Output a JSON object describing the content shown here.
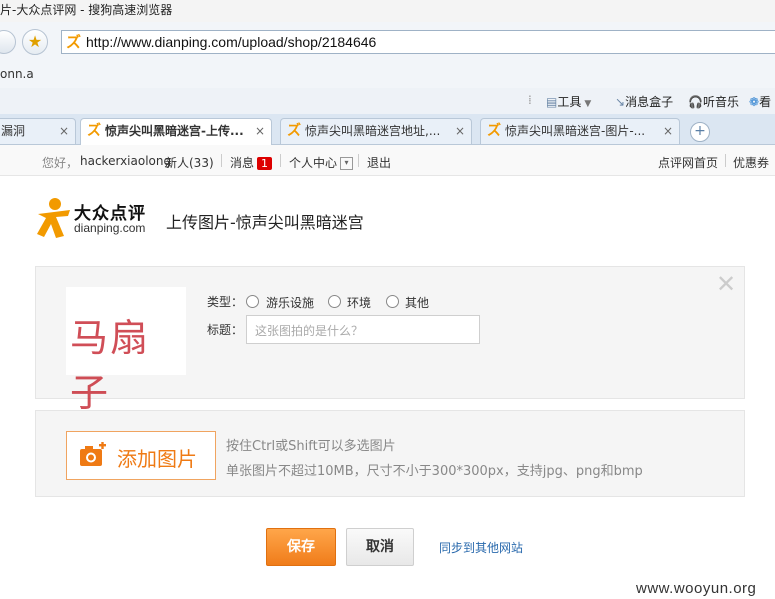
{
  "window": {
    "title": "片-大众点评网 - 搜狗高速浏览器"
  },
  "address": {
    "url": "http://www.dianping.com/upload/shop/2184646"
  },
  "bookmarks": {
    "item": "onn.a"
  },
  "toolbar": {
    "tools": "工具",
    "msgbox": "消息盒子",
    "music": "听音乐",
    "more": "看"
  },
  "tabs": [
    {
      "label": "漏洞",
      "close": "×"
    },
    {
      "label": "惊声尖叫黑暗迷宫-上传...",
      "close": "×"
    },
    {
      "label": "惊声尖叫黑暗迷宫地址,...",
      "close": "×"
    },
    {
      "label": "惊声尖叫黑暗迷宫-图片-...",
      "close": "×"
    }
  ],
  "newtab": "+",
  "userbar": {
    "greeting": "您好，",
    "username": "hackerxiaolong",
    "newpeople": "新人(33)",
    "messages": "消息",
    "msgcount": "1",
    "personal": "个人中心",
    "logout": "退出",
    "home": "点评网首页",
    "coupons": "优惠券"
  },
  "logo": {
    "cn": "大众点评",
    "en": "dianping.com"
  },
  "page": {
    "title": "上传图片-惊声尖叫黑暗迷宫"
  },
  "form": {
    "thumb_text": "马扇子",
    "type_label": "类型：",
    "options": [
      "游乐设施",
      "环境",
      "其他"
    ],
    "title_label": "标题：",
    "title_placeholder": "这张图拍的是什么？",
    "close": "✕"
  },
  "upload": {
    "button": "添加图片",
    "hint1": "按住Ctrl或Shift可以多选图片",
    "hint2": "单张图片不超过10MB，尺寸不小于300*300px，支持jpg、png和bmp"
  },
  "actions": {
    "save": "保存",
    "cancel": "取消",
    "sync": "同步到其他网站"
  },
  "watermark": "www.wooyun.org",
  "colors": {
    "accent": "#f07c1a",
    "link": "#2a6aad",
    "badge": "#dd0000"
  }
}
